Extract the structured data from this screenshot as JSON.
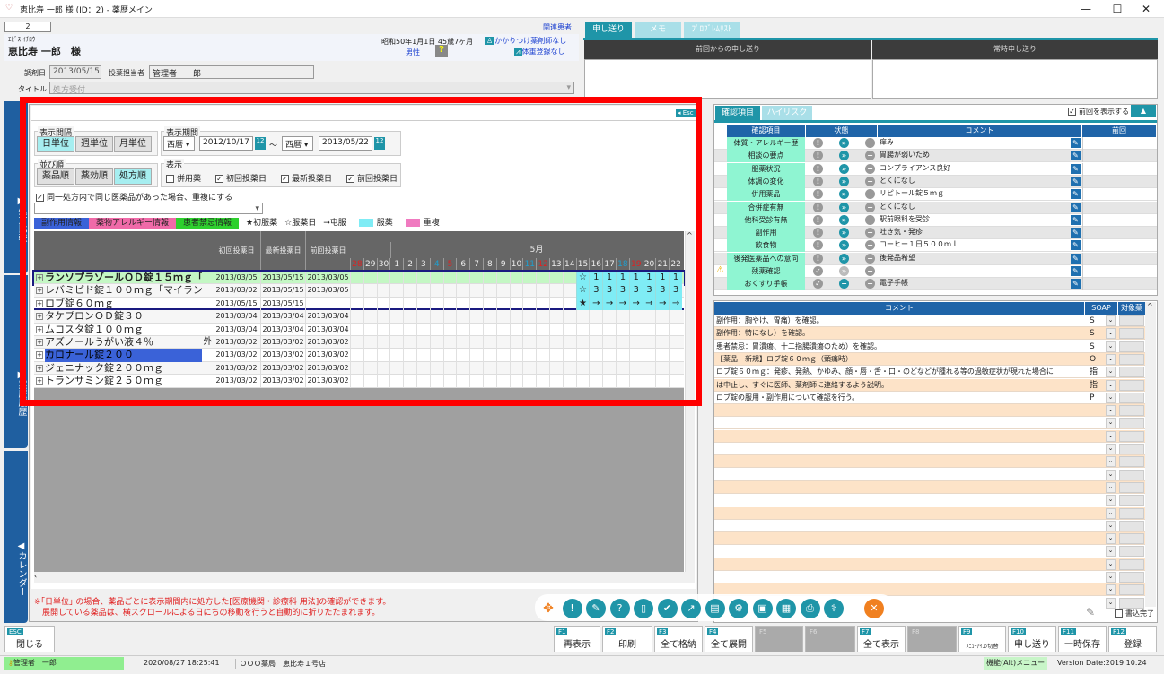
{
  "window": {
    "title": "恵比寿 一郎 様 (ID：2) - 薬歴メイン",
    "min": "—",
    "max": "☐",
    "close": "✕"
  },
  "patient": {
    "id": "2",
    "related": "関連患者",
    "kana": "ｴﾋﾞｽ ｲﾁﾛｳ",
    "name": "恵比寿 一郎　様",
    "birth": "昭和50年1月1日  45歳7ヶ月",
    "gender": "男性",
    "pharmacist": "かかりつけ薬剤師なし",
    "weight": "体重登録なし",
    "dispense_label": "調剤日",
    "dispense_date": "2013/05/15",
    "staff_label": "投薬担当者",
    "staff": "管理者　一郎",
    "title_label": "タイトル",
    "title_value": "処方受付"
  },
  "sidetabs": [
    "▶処方比較",
    "▶薬歴履歴",
    "◀カレンダー"
  ],
  "calendar": {
    "esc": "◂ Esc",
    "interval_label": "表示間隔",
    "interval": [
      "日単位",
      "週単位",
      "月単位"
    ],
    "interval_selected": 0,
    "period_label": "表示期間",
    "era1": "西暦",
    "from": "2012/10/17",
    "tilde": "～",
    "era2": "西暦",
    "to": "2013/05/22",
    "sort_label": "並び順",
    "sort": [
      "薬品順",
      "薬効順",
      "処方順"
    ],
    "sort_selected": 2,
    "display_label": "表示",
    "display": [
      {
        "label": "併用薬",
        "checked": false
      },
      {
        "label": "初回投薬日",
        "checked": true
      },
      {
        "label": "最新投薬日",
        "checked": true
      },
      {
        "label": "前回投薬日",
        "checked": true
      }
    ],
    "dup_label": "同一処方内で同じ医薬品があった場合、重複にする",
    "dup_checked": true,
    "legend": [
      {
        "label": "副作用情報",
        "color": "#3a62d8"
      },
      {
        "label": "薬物アレルギー情報",
        "color": "#f06aa8"
      },
      {
        "label": "患者禁忌情報",
        "color": "#2ed02e"
      }
    ],
    "legend_marks": [
      "★初服薬",
      "☆服薬日",
      "→屯服"
    ],
    "legend_fill": [
      {
        "label": "服薬",
        "color": "#7fecf5"
      },
      {
        "label": "重複",
        "color": "#f07ac0"
      }
    ],
    "col_headers": [
      "初回投薬日",
      "最新投薬日",
      "前回投薬日"
    ],
    "month": "5月",
    "days": [
      {
        "d": "28",
        "c": "red"
      },
      {
        "d": "29"
      },
      {
        "d": "30"
      },
      {
        "d": "1"
      },
      {
        "d": "2"
      },
      {
        "d": "3"
      },
      {
        "d": "4",
        "c": "blue"
      },
      {
        "d": "5",
        "c": "red"
      },
      {
        "d": "6"
      },
      {
        "d": "7"
      },
      {
        "d": "8"
      },
      {
        "d": "9"
      },
      {
        "d": "10"
      },
      {
        "d": "11",
        "c": "blue"
      },
      {
        "d": "12",
        "c": "red"
      },
      {
        "d": "13"
      },
      {
        "d": "14"
      },
      {
        "d": "15"
      },
      {
        "d": "16"
      },
      {
        "d": "17"
      },
      {
        "d": "18",
        "c": "blue"
      },
      {
        "d": "19",
        "c": "red"
      },
      {
        "d": "20"
      },
      {
        "d": "21"
      },
      {
        "d": "22"
      }
    ],
    "rows": [
      {
        "name": "ランソプラゾールＯＤ錠１５ｍｇ「トー",
        "ext": "",
        "first": "2013/03/05",
        "latest": "2013/05/15",
        "prev": "2013/03/05",
        "marks": [
          "☆",
          "1",
          "1",
          "1",
          "1",
          "1",
          "1",
          "1"
        ]
      },
      {
        "name": "レバミピド錠１００ｍｇ「マイラン」",
        "ext": "",
        "first": "2013/03/02",
        "latest": "2013/05/15",
        "prev": "2013/03/05",
        "marks": [
          "☆",
          "3",
          "3",
          "3",
          "3",
          "3",
          "3",
          "3"
        ]
      },
      {
        "name": "ロブ錠６０ｍｇ",
        "ext": "",
        "first": "2013/05/15",
        "latest": "2013/05/15",
        "prev": "",
        "marks": [
          "★",
          "→",
          "→",
          "→",
          "→",
          "→",
          "→",
          "→"
        ]
      },
      {
        "name": "タケプロンＯＤ錠３０",
        "ext": "",
        "first": "2013/03/04",
        "latest": "2013/03/04",
        "prev": "2013/03/04",
        "marks": []
      },
      {
        "name": "ムコスタ錠１００ｍｇ",
        "ext": "",
        "first": "2013/03/04",
        "latest": "2013/03/04",
        "prev": "2013/03/04",
        "marks": []
      },
      {
        "name": "アズノールうがい液４％",
        "ext": "外",
        "first": "2013/03/02",
        "latest": "2013/03/02",
        "prev": "2013/03/02",
        "marks": []
      },
      {
        "name": "カロナール錠２００",
        "ext": "",
        "first": "2013/03/02",
        "latest": "2013/03/02",
        "prev": "2013/03/02",
        "marks": []
      },
      {
        "name": "ジェニナック錠２００ｍｇ",
        "ext": "",
        "first": "2013/03/02",
        "latest": "2013/03/02",
        "prev": "2013/03/02",
        "marks": []
      },
      {
        "name": "トランサミン錠２５０ｍｇ",
        "ext": "",
        "first": "2013/03/02",
        "latest": "2013/03/02",
        "prev": "2013/03/02",
        "marks": []
      }
    ],
    "note1": "※｢日単位｣ の場合、薬品ごとに表示期間内に処方した[医療機関・診療科 用法]の確認ができます。",
    "note2": "　展開している薬品は、横スクロールによる日にちの移動を行うと自動的に折りたたまれます。"
  },
  "handoff": {
    "tabs": [
      "申し送り",
      "メモ",
      "ﾌﾟﾛﾌﾞﾚﾑﾘｽﾄ"
    ],
    "prev_header": "前回からの申し送り",
    "always_header": "常時申し送り"
  },
  "check": {
    "tabs": [
      "確認項目",
      "ハイリスク"
    ],
    "show_prev": "前回を表示する",
    "headers": [
      "確認項目",
      "状態",
      "コメント",
      "前回"
    ],
    "items": [
      {
        "label": "体質・アレルギー歴",
        "state": "next",
        "comment": "痒み"
      },
      {
        "label": "相談の要点",
        "state": "next",
        "comment": "胃腸が弱いため"
      },
      {
        "label": "服薬状況",
        "state": "next",
        "comment": "コンプライアンス良好"
      },
      {
        "label": "体調の変化",
        "state": "next",
        "comment": "とくになし"
      },
      {
        "label": "併用薬品",
        "state": "next",
        "comment": "リピトール錠５ｍｇ"
      },
      {
        "label": "合併症有無",
        "state": "next",
        "comment": "とくになし"
      },
      {
        "label": "他科受診有無",
        "state": "next",
        "comment": "駅前眼科を受診"
      },
      {
        "label": "副作用",
        "state": "next",
        "comment": "吐き気・発疹"
      },
      {
        "label": "飲食物",
        "state": "next",
        "comment": "コーヒー１日５００ｍｌ"
      },
      {
        "label": "後発医薬品への意向",
        "state": "next",
        "comment": "後発品希望"
      },
      {
        "label": "残薬確認",
        "state": "check",
        "comment": "",
        "warning": true
      },
      {
        "label": "おくすり手帳",
        "state": "minus",
        "comment": "電子手帳"
      }
    ]
  },
  "soap": {
    "headers": [
      "コメント",
      "SOAP",
      "対象薬"
    ],
    "rows": [
      {
        "comment": "副作用：胸やけ、胃痛）を確認。",
        "soap": "S"
      },
      {
        "comment": "副作用：特になし）を確認。",
        "soap": "S"
      },
      {
        "comment": "患者禁忌：胃潰瘍、十二指腸潰瘍のため）を確認。",
        "soap": "S"
      },
      {
        "comment": "【薬品　新規】ロブ錠６０ｍｇ（頭痛時）",
        "soap": "O"
      },
      {
        "comment": "ロブ錠６０ｍｇ：発疹、発熱、かゆみ、顔・唇・舌・口・のどなどが腫れる等の過敏症状が現れた場合に",
        "soap": "指"
      },
      {
        "comment": "は中止し、すぐに医師、薬剤師に連絡するよう説明。",
        "soap": "指"
      },
      {
        "comment": "ロブ錠の服用・副作用について確認を行う。",
        "soap": "P"
      }
    ],
    "done_label": "書込完了"
  },
  "toolbar_icons": [
    "move-icon",
    "alert-icon",
    "edit-icon",
    "question-icon",
    "document-icon",
    "user-check-icon",
    "chart-icon",
    "notebook-icon",
    "network-icon",
    "id-card-icon",
    "register-icon",
    "printer-icon",
    "doctor-icon",
    "close-circle-icon"
  ],
  "fkeys": [
    {
      "k": "F1",
      "l": "再表示"
    },
    {
      "k": "F2",
      "l": "印刷"
    },
    {
      "k": "F3",
      "l": "全て格納"
    },
    {
      "k": "F4",
      "l": "全て展開"
    },
    {
      "k": "F5",
      "l": ""
    },
    {
      "k": "F6",
      "l": ""
    },
    {
      "k": "F7",
      "l": "全て表示"
    },
    {
      "k": "F8",
      "l": ""
    },
    {
      "k": "F9",
      "l": "ﾒﾆｭｰｱｲｺﾝ切替"
    },
    {
      "k": "F10",
      "l": "申し送り"
    },
    {
      "k": "F11",
      "l": "一時保存"
    },
    {
      "k": "F12",
      "l": "登録"
    }
  ],
  "esc_key": {
    "k": "ESC",
    "l": "閉じる"
  },
  "status": {
    "user": "管理者　一郎",
    "datetime": "2020/08/27 18:25:41",
    "store": "ＯＯＯ薬局　恵比寿１号店",
    "menu": "機能(Alt)メニュー",
    "version": "Version Date:2019.10.24"
  },
  "colors": {
    "accent": "#1f95a8",
    "sidetab": "#1f5fa0",
    "highlight_row": "#c4f7c4",
    "dose_fill": "#7fecf5",
    "annotation": "#ff0000"
  }
}
